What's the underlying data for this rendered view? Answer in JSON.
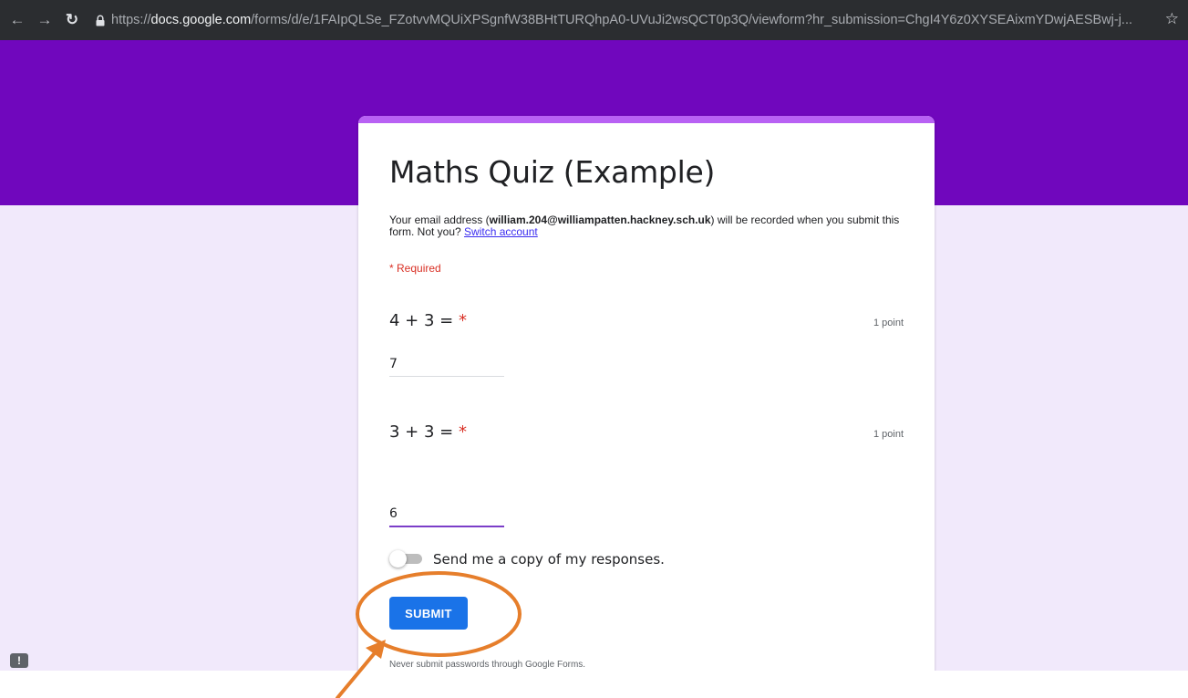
{
  "browser": {
    "url_prefix": "https://",
    "url_host": "docs.google.com",
    "url_path": "/forms/d/e/1FAIpQLSe_FZotvvMQUiXPSgnfW38BHtTURQhpA0-UVuJi2wsQCT0p3Q/viewform?hr_submission=ChgI4Y6z0XYSEAixmYDwjAESBwj-j..."
  },
  "form": {
    "title": "Maths Quiz (Example)",
    "email_prefix": "Your email address (",
    "email": "william.204@williampatten.hackney.sch.uk",
    "email_suffix": ") will be recorded when you submit this form. Not you? ",
    "switch_account": "Switch account",
    "required_note": "* Required",
    "questions": [
      {
        "text": "4 + 3 = ",
        "required_marker": "*",
        "points": "1 point",
        "answer": "7"
      },
      {
        "text": "3 + 3 = ",
        "required_marker": "*",
        "points": "1 point",
        "answer": "6"
      }
    ],
    "copy_toggle_label": "Send me a copy of my responses.",
    "copy_toggle_on": false,
    "submit_label": "SUBMIT",
    "footer_note": "Never submit passwords through Google Forms."
  },
  "colors": {
    "banner": "#7007bd",
    "page_bg": "#f1e9fb",
    "card_accent": "#b861f4",
    "submit": "#1a73e8",
    "annotation": "#e67e2b"
  },
  "icons": {
    "back": "back-arrow-icon",
    "forward": "forward-arrow-icon",
    "reload": "reload-icon",
    "lock": "lock-icon",
    "bookmark": "star-icon",
    "report": "report-icon"
  }
}
